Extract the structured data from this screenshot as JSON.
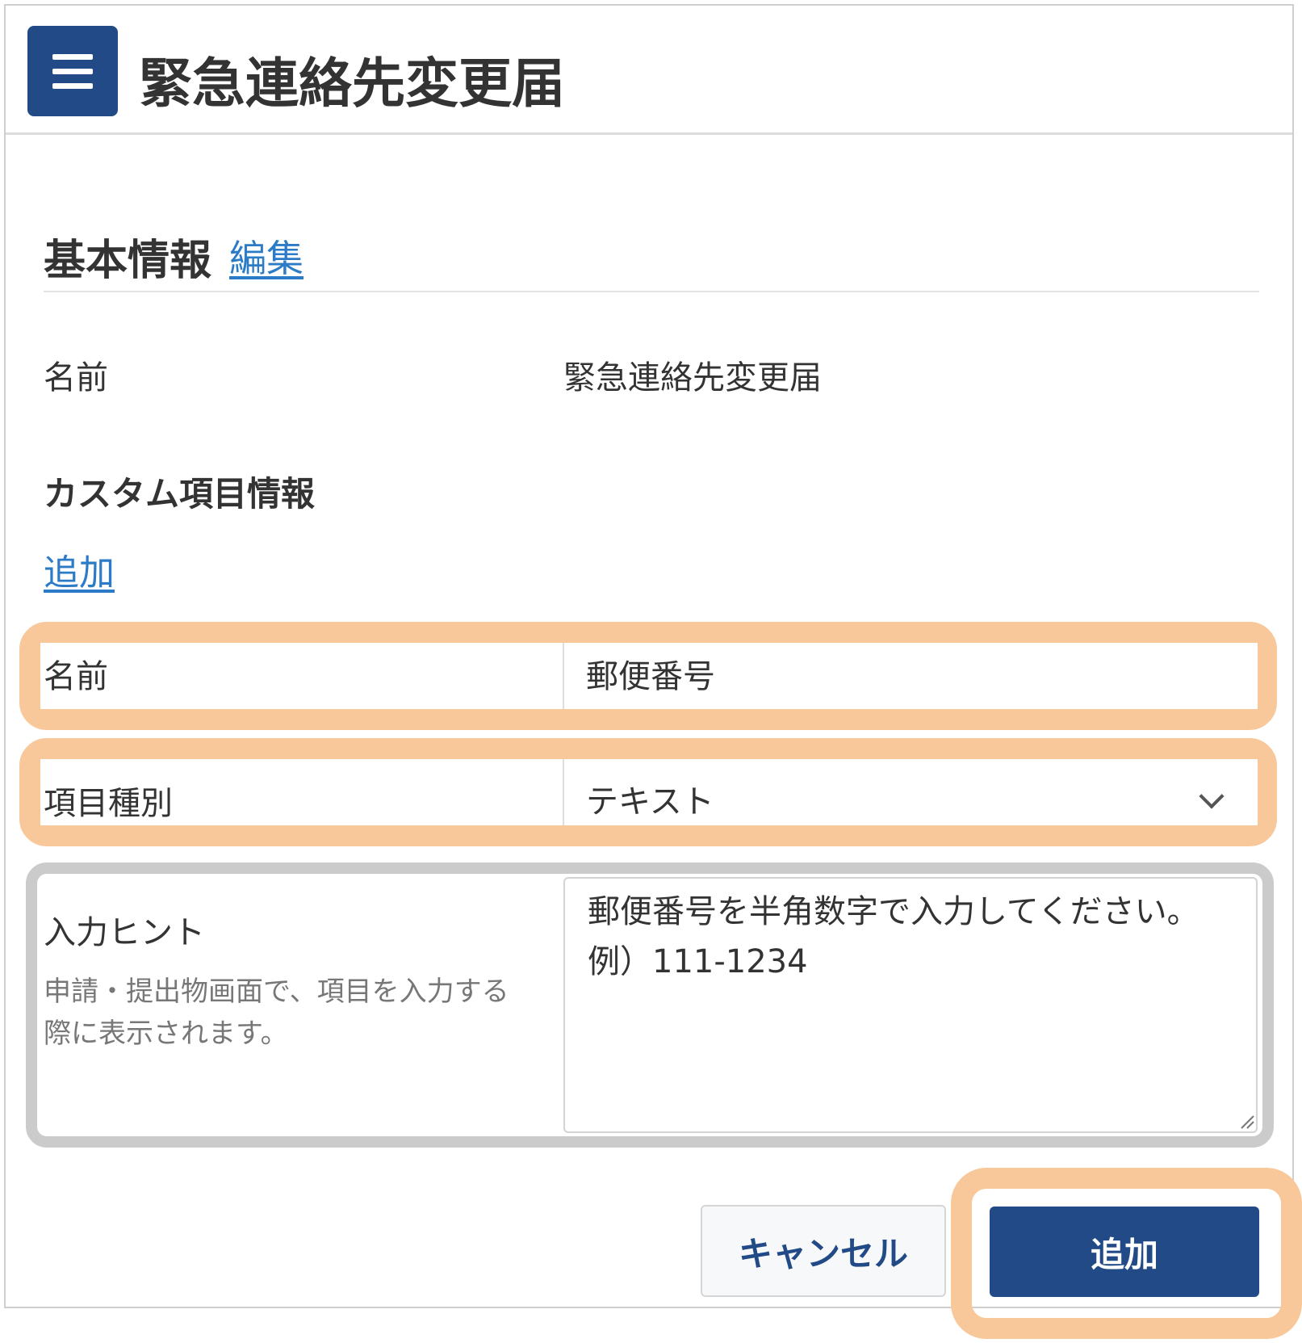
{
  "header": {
    "title": "緊急連絡先変更届"
  },
  "basic_info": {
    "heading": "基本情報",
    "edit_link": "編集",
    "name_label": "名前",
    "name_value": "緊急連絡先変更届"
  },
  "custom_fields": {
    "heading": "カスタム項目情報",
    "add_link": "追加"
  },
  "form": {
    "name_label": "名前",
    "name_value": "郵便番号",
    "type_label": "項目種別",
    "type_value": "テキスト",
    "hint_label": "入力ヒント",
    "hint_description": "申請・提出物画面で、項目を入力する際に表示されます。",
    "hint_value_line1": "郵便番号を半角数字で入力してください。",
    "hint_value_line2": "例）111-1234"
  },
  "buttons": {
    "cancel": "キャンセル",
    "add": "追加"
  },
  "colors": {
    "primary": "#224a86",
    "link": "#2b7bc6",
    "highlight": "#f8c89b"
  }
}
